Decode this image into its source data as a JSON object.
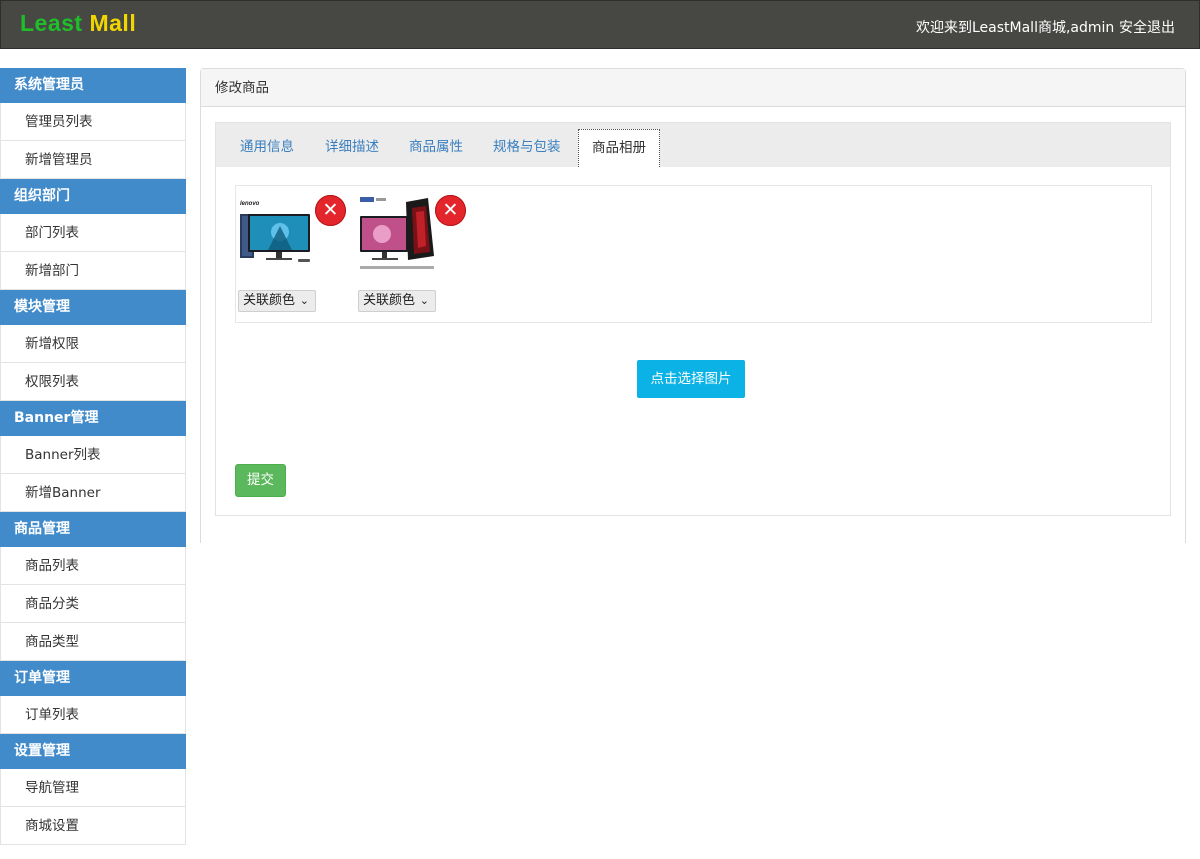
{
  "header": {
    "logo_part1": "Least",
    "logo_part2": "Mall",
    "welcome": "欢迎来到LeastMall商城,admin",
    "logout": "安全退出"
  },
  "sidebar": {
    "groups": [
      {
        "title": "系统管理员",
        "items": [
          "管理员列表",
          "新增管理员"
        ]
      },
      {
        "title": "组织部门",
        "items": [
          "部门列表",
          "新增部门"
        ]
      },
      {
        "title": "模块管理",
        "items": [
          "新增权限",
          "权限列表"
        ]
      },
      {
        "title": "Banner管理",
        "items": [
          "Banner列表",
          "新增Banner"
        ]
      },
      {
        "title": "商品管理",
        "items": [
          "商品列表",
          "商品分类",
          "商品类型"
        ]
      },
      {
        "title": "订单管理",
        "items": [
          "订单列表"
        ]
      },
      {
        "title": "设置管理",
        "items": [
          "导航管理",
          "商城设置"
        ]
      }
    ]
  },
  "panel": {
    "title": "修改商品",
    "tabs": [
      "通用信息",
      "详细描述",
      "商品属性",
      "规格与包装",
      "商品相册"
    ],
    "active_tab": "商品相册",
    "photos": [
      {
        "brand": "lenovo",
        "select": "关联颜色",
        "delete_icon": "close-icon"
      },
      {
        "brand": "",
        "select": "关联颜色",
        "delete_icon": "close-icon"
      }
    ],
    "pick_button": "点击选择图片",
    "submit_button": "提交"
  },
  "colors": {
    "header_bg": "#474743",
    "sidebar_group": "#428bca",
    "pick_button": "#0bb2e6",
    "submit_button": "#5cb85c",
    "delete": "#e3262b"
  }
}
